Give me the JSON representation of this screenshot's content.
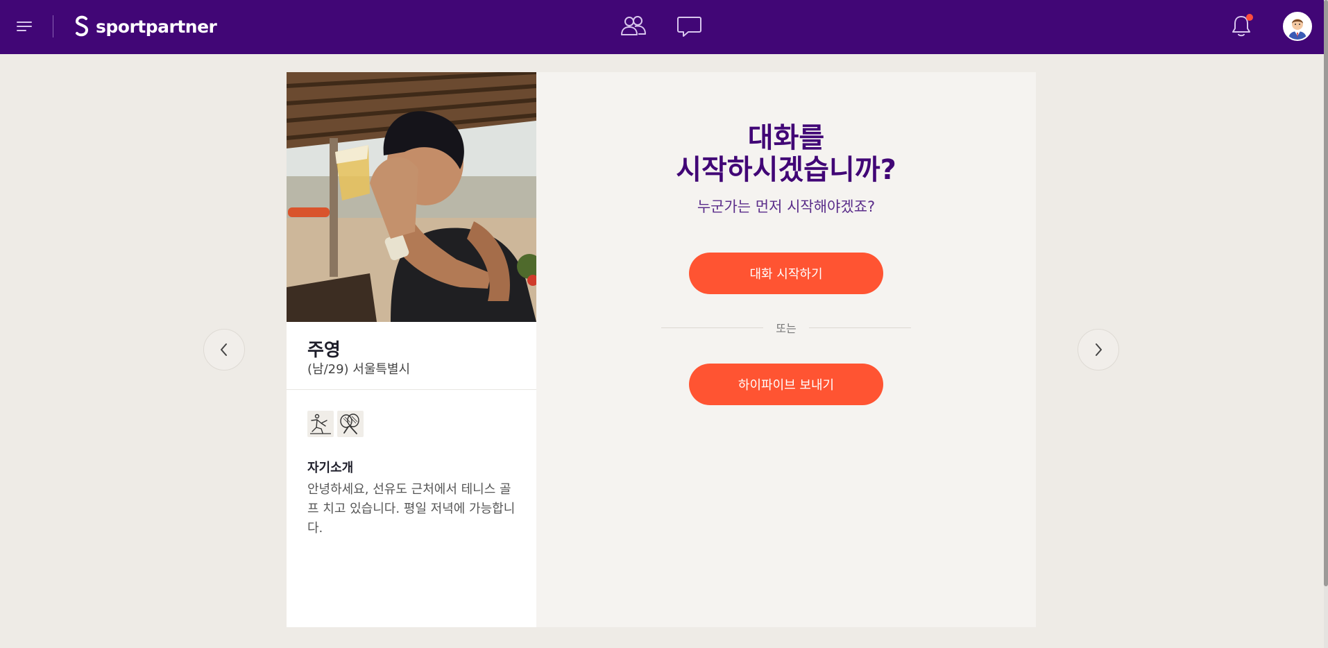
{
  "header": {
    "logo_text": "sportpartner",
    "nav": [
      {
        "icon": "partners-icon"
      },
      {
        "icon": "chat-icon"
      }
    ],
    "notification_icon": "bell-icon",
    "brand_color": "#410676",
    "accent_color": "#ff5432"
  },
  "profile": {
    "name": "주영",
    "meta": "(남/29) 서울특별시",
    "sports": [
      {
        "icon": "running-icon"
      },
      {
        "icon": "tennis-icon"
      }
    ],
    "intro_heading": "자기소개",
    "intro_text": "안녕하세요, 선유도 근처에서 테니스 골프 치고 있습니다. 평일 저녁에 가능합니다."
  },
  "chat": {
    "title_line1": "대화를",
    "title_line2": "시작하시겠습니까?",
    "subtitle": "누군가는 먼저 시작해야겠죠?",
    "start_button": "대화 시작하기",
    "or_text": "또는",
    "highfive_button": "하이파이브 보내기"
  }
}
